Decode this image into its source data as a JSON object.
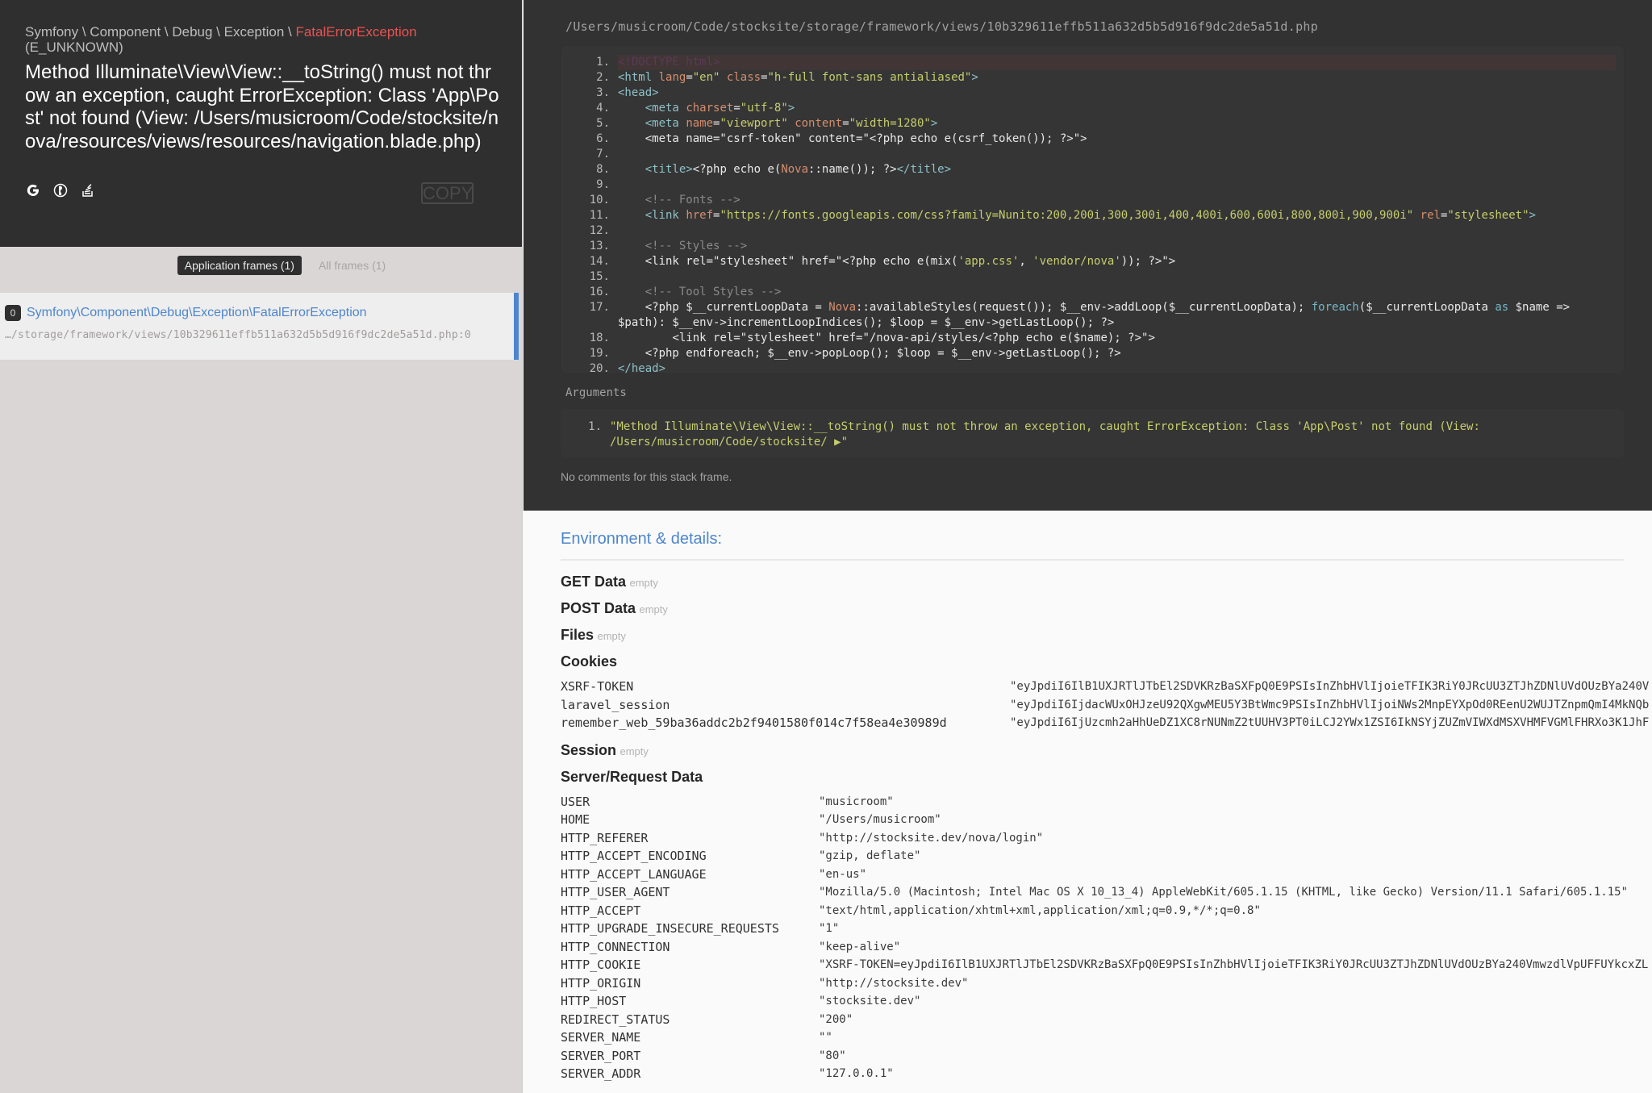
{
  "exception": {
    "namespace_parts": [
      "Symfony",
      "Component",
      "Debug",
      "Exception"
    ],
    "separator": " \\ ",
    "class_short": "FatalErrorException",
    "code": "(E_UNKNOWN)",
    "message": "Method Illuminate\\View\\View::__toString() must not throw an exception, caught ErrorException: Class 'App\\Post' not found (View: /Users/musicroom/Code/stocksite/nova/resources/views/resources/navigation.blade.php)",
    "tools": [
      {
        "name": "google-icon",
        "glyph": "G"
      },
      {
        "name": "duckduckgo-icon",
        "glyph": "◐"
      },
      {
        "name": "stackoverflow-icon",
        "glyph": "≣"
      }
    ],
    "copy_label": "COPY"
  },
  "frames": {
    "tabs": [
      {
        "label": "Application frames (1)",
        "active": true
      },
      {
        "label": "All frames (1)",
        "active": false
      }
    ],
    "items": [
      {
        "index": "0",
        "class": "Symfony\\Component\\Debug\\Exception\\FatalErrorException",
        "file": "…/storage/framework/views/10b329611effb511a632d5b5d916f9dc2de5a51d.php:0"
      }
    ]
  },
  "code": {
    "file_path": "/Users/musicroom/Code/stocksite/storage/framework/views/10b329611effb511a632d5b5d916f9dc2de5a51d.php",
    "lines": [
      {
        "n": "1.",
        "text": "<!DOCTYPE html>",
        "highlight": true
      },
      {
        "n": "2.",
        "text": "<html lang=\"en\" class=\"h-full font-sans antialiased\">"
      },
      {
        "n": "3.",
        "text": "<head>"
      },
      {
        "n": "4.",
        "text": "    <meta charset=\"utf-8\">"
      },
      {
        "n": "5.",
        "text": "    <meta name=\"viewport\" content=\"width=1280\">"
      },
      {
        "n": "6.",
        "text": "    <meta name=\"csrf-token\" content=\"<?php echo e(csrf_token()); ?>\">"
      },
      {
        "n": "7.",
        "text": ""
      },
      {
        "n": "8.",
        "text": "    <title><?php echo e(Nova::name()); ?></title>"
      },
      {
        "n": "9.",
        "text": ""
      },
      {
        "n": "10.",
        "text": "    <!-- Fonts -->"
      },
      {
        "n": "11.",
        "text": "    <link href=\"https://fonts.googleapis.com/css?family=Nunito:200,200i,300,300i,400,400i,600,600i,800,800i,900,900i\" rel=\"stylesheet\">"
      },
      {
        "n": "12.",
        "text": ""
      },
      {
        "n": "13.",
        "text": "    <!-- Styles -->"
      },
      {
        "n": "14.",
        "text": "    <link rel=\"stylesheet\" href=\"<?php echo e(mix('app.css', 'vendor/nova')); ?>\">"
      },
      {
        "n": "15.",
        "text": ""
      },
      {
        "n": "16.",
        "text": "    <!-- Tool Styles -->"
      },
      {
        "n": "17.",
        "text": "    <?php $__currentLoopData = Nova::availableStyles(request()); $__env->addLoop($__currentLoopData); foreach($__currentLoopData as $name => $path): $__env->incrementLoopIndices(); $loop = $__env->getLastLoop(); ?>"
      },
      {
        "n": "18.",
        "text": "        <link rel=\"stylesheet\" href=\"/nova-api/styles/<?php echo e($name); ?>\">"
      },
      {
        "n": "19.",
        "text": "    <?php endforeach; $__env->popLoop(); $loop = $__env->getLastLoop(); ?>"
      },
      {
        "n": "20.",
        "text": "</head>"
      }
    ],
    "arguments_label": "Arguments",
    "arguments": [
      {
        "n": "1.",
        "text": "\"Method Illuminate\\View\\View::__toString() must not throw an exception, caught ErrorException: Class 'App\\Post' not found (View: /Users/musicroom/Code/stocksite/ ▶\""
      }
    ],
    "no_comments": "No comments for this stack frame."
  },
  "env": {
    "title": "Environment & details:",
    "get": {
      "title": "GET Data",
      "empty": "empty"
    },
    "post": {
      "title": "POST Data",
      "empty": "empty"
    },
    "files": {
      "title": "Files",
      "empty": "empty"
    },
    "cookies": {
      "title": "Cookies",
      "rows": [
        {
          "k": "XSRF-TOKEN",
          "v": "\"eyJpdiI6IlB1UXJRTlJTbEl2SDVKRzBaSXFpQ0E9PSIsInZhbHVlIjoieTFIK3RiY0JRcUU3ZTJhZDNlUVdOUzBYa240V"
        },
        {
          "k": "laravel_session",
          "v": "\"eyJpdiI6IjdacWUxOHJzeU92QXgwMEU5Y3BtWmc9PSIsInZhbHVlIjoiNWs2MnpEYXpOd0REenU2WUJTZnpmQmI4MkNQb"
        },
        {
          "k": "remember_web_59ba36addc2b2f9401580f014c7f58ea4e30989d",
          "v": "\"eyJpdiI6IjUzcmh2aHhUeDZ1XC8rNUNmZ2tUUHV3PT0iLCJ2YWx1ZSI6IkNSYjZUZmVIWXdMSXVHMFVGMlFHRXo3K1JhF"
        }
      ]
    },
    "session": {
      "title": "Session",
      "empty": "empty"
    },
    "server": {
      "title": "Server/Request Data",
      "rows": [
        {
          "k": "USER",
          "v": "\"musicroom\""
        },
        {
          "k": "HOME",
          "v": "\"/Users/musicroom\""
        },
        {
          "k": "HTTP_REFERER",
          "v": "\"http://stocksite.dev/nova/login\""
        },
        {
          "k": "HTTP_ACCEPT_ENCODING",
          "v": "\"gzip, deflate\""
        },
        {
          "k": "HTTP_ACCEPT_LANGUAGE",
          "v": "\"en-us\""
        },
        {
          "k": "HTTP_USER_AGENT",
          "v": "\"Mozilla/5.0 (Macintosh; Intel Mac OS X 10_13_4) AppleWebKit/605.1.15 (KHTML, like Gecko) Version/11.1 Safari/605.1.15\""
        },
        {
          "k": "HTTP_ACCEPT",
          "v": "\"text/html,application/xhtml+xml,application/xml;q=0.9,*/*;q=0.8\""
        },
        {
          "k": "HTTP_UPGRADE_INSECURE_REQUESTS",
          "v": "\"1\""
        },
        {
          "k": "HTTP_CONNECTION",
          "v": "\"keep-alive\""
        },
        {
          "k": "HTTP_COOKIE",
          "v": "\"XSRF-TOKEN=eyJpdiI6IlB1UXJRTlJTbEl2SDVKRzBaSXFpQ0E9PSIsInZhbHVlIjoieTFIK3RiY0JRcUU3ZTJhZDNlUVdOUzBYa240VmwzdlVpUFFUYkcxZL"
        },
        {
          "k": "HTTP_ORIGIN",
          "v": "\"http://stocksite.dev\""
        },
        {
          "k": "HTTP_HOST",
          "v": "\"stocksite.dev\""
        },
        {
          "k": "REDIRECT_STATUS",
          "v": "\"200\""
        },
        {
          "k": "SERVER_NAME",
          "v": "\"\""
        },
        {
          "k": "SERVER_PORT",
          "v": "\"80\""
        },
        {
          "k": "SERVER_ADDR",
          "v": "\"127.0.0.1\""
        }
      ]
    }
  },
  "colors": {
    "accent_blue": "#4d86cc",
    "error_red": "#e95353",
    "dark_bg": "#2f2f2f",
    "code_bg": "#323232"
  }
}
